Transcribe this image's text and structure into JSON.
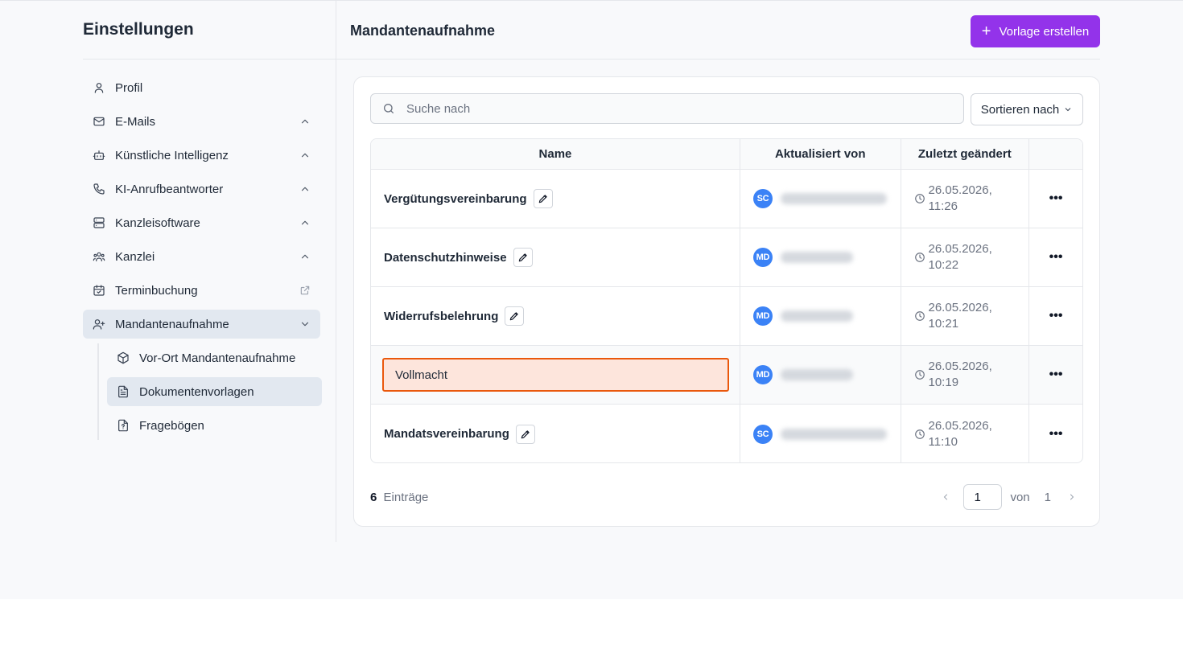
{
  "sidebar": {
    "title": "Einstellungen",
    "items": [
      {
        "label": "Profil",
        "icon": "user-icon"
      },
      {
        "label": "E-Mails",
        "icon": "mail-icon",
        "trail": "chevron-up-icon"
      },
      {
        "label": "Künstliche Intelligenz",
        "icon": "bot-icon",
        "trail": "chevron-up-icon"
      },
      {
        "label": "KI-Anrufbeantworter",
        "icon": "phone-icon",
        "trail": "chevron-up-icon"
      },
      {
        "label": "Kanzleisoftware",
        "icon": "server-icon",
        "trail": "chevron-up-icon"
      },
      {
        "label": "Kanzlei",
        "icon": "users-icon",
        "trail": "chevron-up-icon"
      },
      {
        "label": "Terminbuchung",
        "icon": "calendar-check-icon",
        "trail": "external-link-icon"
      },
      {
        "label": "Mandantenaufnahme",
        "icon": "user-plus-icon",
        "trail": "chevron-down-icon"
      }
    ],
    "subitems": [
      {
        "label": "Vor-Ort Mandantenaufnahme",
        "icon": "package-icon"
      },
      {
        "label": "Dokumentenvorlagen",
        "icon": "file-text-icon"
      },
      {
        "label": "Fragebögen",
        "icon": "file-question-icon"
      }
    ]
  },
  "header": {
    "title": "Mandantenaufnahme",
    "create_button": "Vorlage erstellen"
  },
  "search": {
    "placeholder": "Suche nach",
    "value": ""
  },
  "sort": {
    "label": "Sortieren nach"
  },
  "table": {
    "columns": [
      "Name",
      "Aktualisiert von",
      "Zuletzt geändert",
      ""
    ],
    "rows": [
      {
        "name": "Vergütungsvereinbarung",
        "initials": "SC",
        "date": "26.05.2026,",
        "time": "11:26"
      },
      {
        "name": "Datenschutzhinweise",
        "initials": "MD",
        "date": "26.05.2026,",
        "time": "10:22"
      },
      {
        "name": "Widerrufsbelehrung",
        "initials": "MD",
        "date": "26.05.2026,",
        "time": "10:21"
      },
      {
        "name": "Vollmacht",
        "initials": "MD",
        "date": "26.05.2026,",
        "time": "10:19",
        "editing": true
      },
      {
        "name": "Mandatsvereinbarung",
        "initials": "SC",
        "date": "26.05.2026,",
        "time": "11:10"
      }
    ],
    "actions_glyph": "•••"
  },
  "footer": {
    "count": "6",
    "count_label": "Einträge",
    "page": "1",
    "of_label": "von",
    "total_pages": "1"
  },
  "colors": {
    "accent": "#9333ea",
    "avatar": "#3b82f6",
    "edit_border": "#ea580c"
  }
}
